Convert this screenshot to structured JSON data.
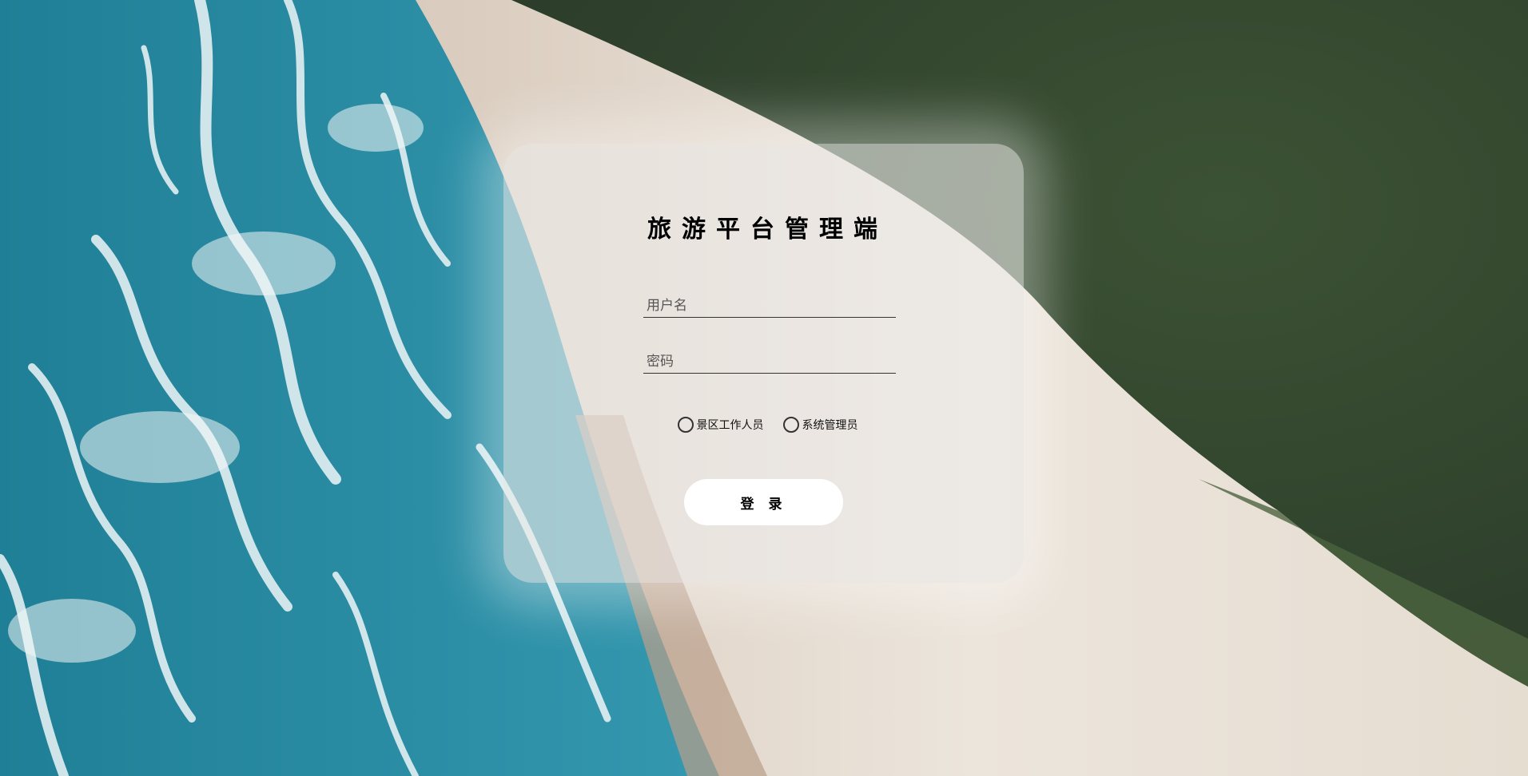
{
  "background": {
    "scene": "beach-forest-aerial",
    "colors": {
      "ocean_deep": "#1f7f96",
      "ocean_light": "#4fb0c4",
      "foam": "#e8f3f4",
      "sand": "#e7ddd2",
      "sand_dark": "#b69b87",
      "forest": "#33462f",
      "forest_light": "#506a40"
    }
  },
  "login": {
    "title": "旅游平台管理端",
    "username_placeholder": "用户名",
    "password_placeholder": "密码",
    "roles": [
      {
        "label": "景区工作人员",
        "selected": false
      },
      {
        "label": "系统管理员",
        "selected": false
      }
    ],
    "submit_label": "登录"
  }
}
